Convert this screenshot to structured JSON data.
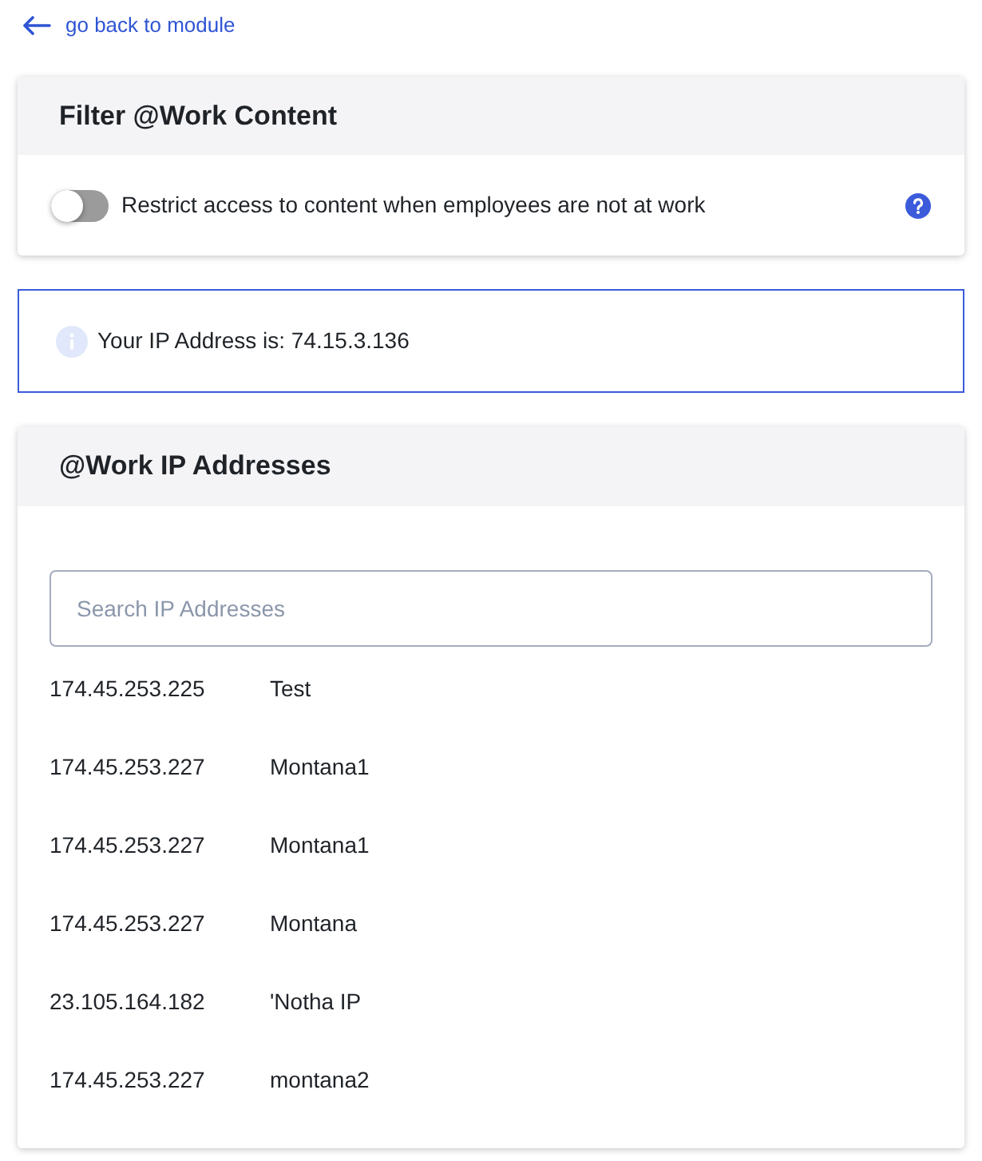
{
  "back_link": {
    "label": "go back to module"
  },
  "filter_card": {
    "title": "Filter @Work Content",
    "toggle": {
      "label": "Restrict access to content when employees are not at work",
      "on": false
    }
  },
  "ip_notice": {
    "text": "Your IP Address is: 74.15.3.136"
  },
  "ip_card": {
    "title": "@Work IP Addresses",
    "search": {
      "placeholder": "Search IP Addresses"
    },
    "rows": [
      {
        "address": "174.45.253.225",
        "name": "Test"
      },
      {
        "address": "174.45.253.227",
        "name": "Montana1"
      },
      {
        "address": "174.45.253.227",
        "name": "Montana1"
      },
      {
        "address": "174.45.253.227",
        "name": "Montana"
      },
      {
        "address": "23.105.164.182",
        "name": "'Notha IP"
      },
      {
        "address": "174.45.253.227",
        "name": "montana2"
      }
    ]
  }
}
